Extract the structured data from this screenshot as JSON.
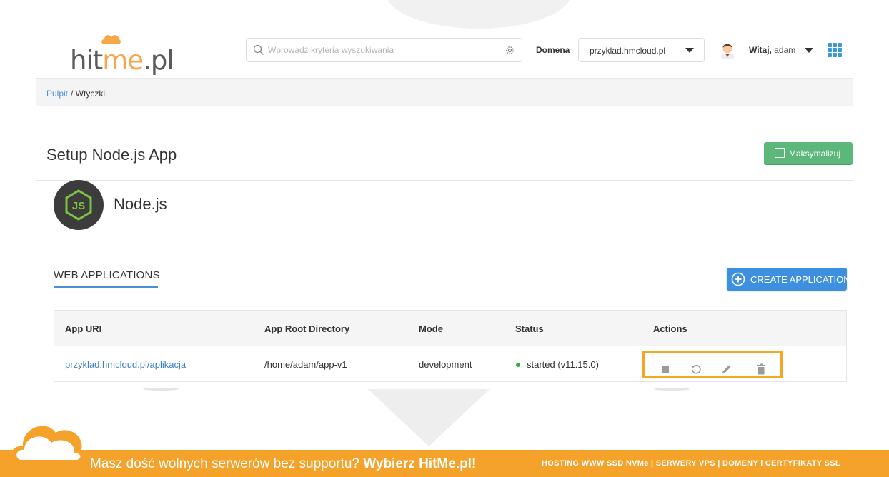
{
  "brand": {
    "logo_text_hit": "hit",
    "logo_text_me": "me",
    "logo_text_pl": ".pl"
  },
  "header": {
    "search_placeholder": "Wprowadź kryteria wyszukiwania",
    "domain_label": "Domena",
    "domain_value": "przyklad.hmcloud.pl",
    "greeting_bold": "Witaj,",
    "greeting_user": " adam"
  },
  "breadcrumb": {
    "home": "Pulpit",
    "current": " / Wtyczki"
  },
  "page": {
    "title": "Setup Node.js App",
    "maximize_label": "Maksymalizuj",
    "app_name": "Node.js"
  },
  "web_apps": {
    "section_title": "WEB APPLICATIONS",
    "create_label": "CREATE APPLICATION",
    "columns": [
      "App URI",
      "App Root Directory",
      "Mode",
      "Status",
      "Actions"
    ],
    "rows": [
      {
        "uri": "przyklad.hmcloud.pl/aplikacja",
        "root": "/home/adam/app-v1",
        "mode": "development",
        "status": "started (v11.15.0)"
      }
    ]
  },
  "footer": {
    "message": "Masz dość wolnych serwerów bez supportu? ",
    "message_bold": "Wybierz HitMe.pl",
    "message_end": "!",
    "right": "HOSTING WWW SSD NVMe | SERWERY VPS | DOMENY i CERTYFIKATY SSL"
  },
  "colors": {
    "accent_orange": "#f5a22b",
    "link_blue": "#4a90d9",
    "maximize_green": "#5cb87a",
    "create_blue": "#3d8fe0",
    "status_green": "#2fae4a",
    "highlight_box": "#f5a623"
  },
  "icons": [
    "search-icon",
    "gear-icon",
    "caret-down-icon",
    "avatar",
    "apps-grid-icon",
    "maximize-icon",
    "nodejs-logo",
    "plus-circle-icon",
    "stop-icon",
    "restart-icon",
    "edit-icon",
    "trash-icon",
    "cloud-icon"
  ]
}
